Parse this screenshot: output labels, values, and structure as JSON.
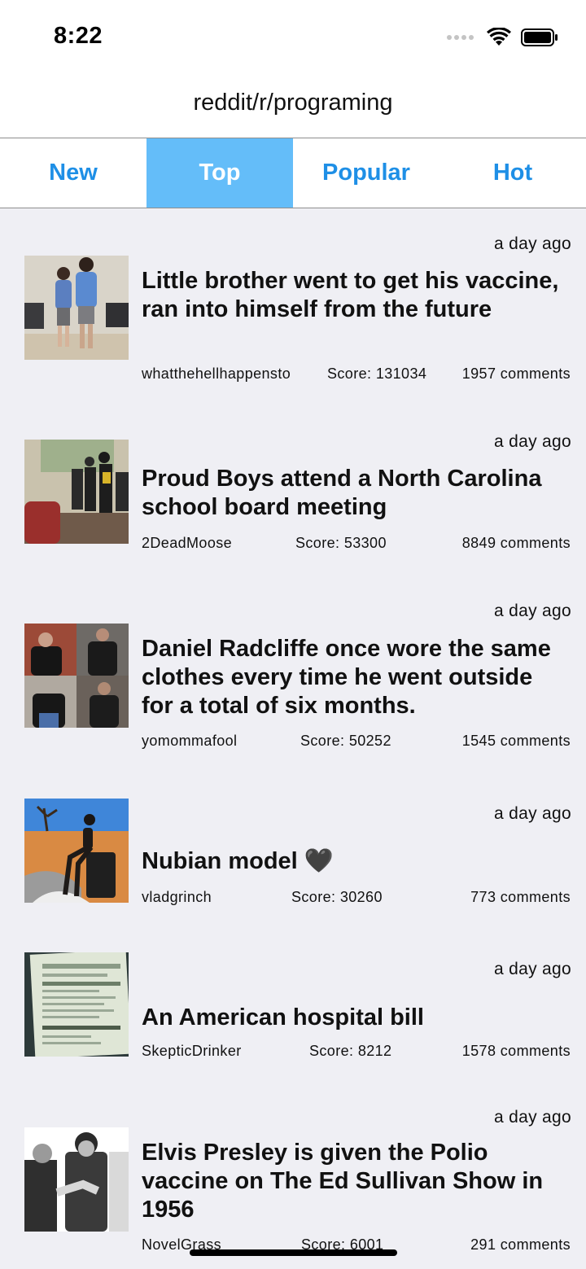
{
  "status_bar": {
    "time": "8:22",
    "icons": [
      "signal-dots-icon",
      "wifi-icon",
      "battery-icon"
    ]
  },
  "header": {
    "title": "reddit/r/programing"
  },
  "tabs": [
    {
      "label": "New",
      "active": false
    },
    {
      "label": "Top",
      "active": true
    },
    {
      "label": "Popular",
      "active": false
    },
    {
      "label": "Hot",
      "active": false
    }
  ],
  "colors": {
    "accent": "#1e8fe6",
    "active_tab_bg": "#64bdf9",
    "feed_bg": "#efeff4"
  },
  "posts": [
    {
      "time": "a day ago",
      "title": "Little brother went to get his vaccine, ran into himself from the future",
      "author": "whatthehellhappensto",
      "score": "Score: 131034",
      "comments": "1957 comments"
    },
    {
      "time": "a day ago",
      "title": "Proud Boys attend a North Carolina school board meeting",
      "author": "2DeadMoose",
      "score": "Score: 53300",
      "comments": "8849 comments"
    },
    {
      "time": "a day ago",
      "title": "Daniel Radcliffe once wore the same clothes every time he went outside for a total of six months.",
      "author": "yomommafool",
      "score": "Score: 50252",
      "comments": "1545 comments"
    },
    {
      "time": "a day ago",
      "title": "Nubian model 🖤",
      "author": "vladgrinch",
      "score": "Score: 30260",
      "comments": "773 comments"
    },
    {
      "time": "a day ago",
      "title": "An American hospital bill",
      "author": "SkepticDrinker",
      "score": "Score: 8212",
      "comments": "1578 comments"
    },
    {
      "time": "a day ago",
      "title": "Elvis Presley is given the Polio vaccine on The Ed Sullivan Show in 1956",
      "author": "NovelGrass",
      "score": "Score: 6001",
      "comments": "291 comments"
    }
  ]
}
